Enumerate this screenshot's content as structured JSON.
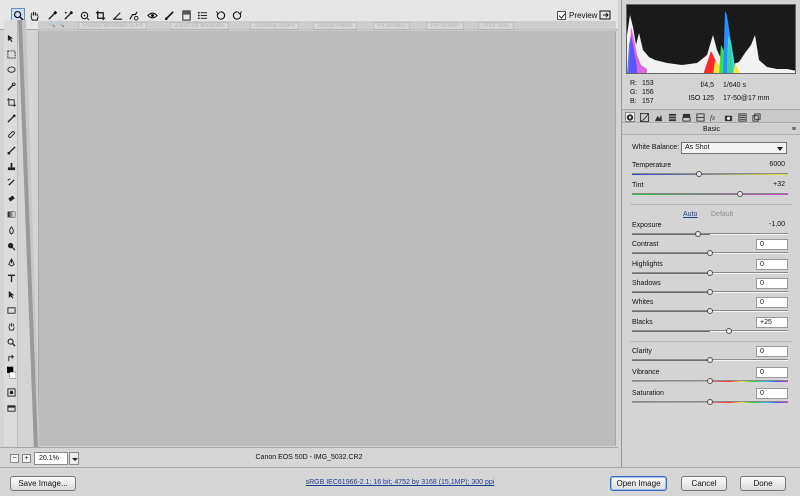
{
  "toolbar": {
    "tools": [
      "zoom-tool-icon",
      "hand-tool-icon",
      "white-balance-tool-icon",
      "color-sampler-tool-icon",
      "target-adjustment-tool-icon",
      "crop-tool-icon",
      "straighten-tool-icon",
      "spot-removal-tool-icon",
      "red-eye-removal-tool-icon",
      "adjustment-brush-icon",
      "graduated-filter-icon",
      "preferences-icon",
      "rotate-left-icon",
      "rotate-right-icon"
    ],
    "preview_label": "Preview",
    "preview_checked": true
  },
  "ghost_options": [
    "Resize Windows to Fit",
    "Zoom All Windows",
    "Scrubby Zoom",
    "Actual Pixels",
    "Fit Screen",
    "Fill Screen",
    "Print Size"
  ],
  "status": {
    "zoom_value": "20.1%",
    "filename": "Canon EOS 50D  -  IMG_5032.CR2"
  },
  "readout": {
    "r_label": "R:",
    "r_value": "153",
    "g_label": "G:",
    "g_value": "156",
    "b_label": "B:",
    "b_value": "157"
  },
  "camera": {
    "aperture": "f/4,5",
    "shutter": "1/640 s",
    "iso": "ISO 125",
    "lens": "17-50@17 mm"
  },
  "panel": {
    "title": "Basic",
    "white_balance_label": "White Balance:",
    "white_balance_value": "As Shot",
    "auto_label": "Auto",
    "default_label": "Default",
    "sliders": [
      {
        "label": "Temperature",
        "value": "6000",
        "pos": 0.43
      },
      {
        "label": "Tint",
        "value": "+32",
        "pos": 0.69
      },
      {
        "label": "Exposure",
        "value": "-1,00",
        "pos": 0.42
      },
      {
        "label": "Contrast",
        "value": "0",
        "pos": 0.5
      },
      {
        "label": "Highlights",
        "value": "0",
        "pos": 0.5
      },
      {
        "label": "Shadows",
        "value": "0",
        "pos": 0.5
      },
      {
        "label": "Whites",
        "value": "0",
        "pos": 0.5
      },
      {
        "label": "Blacks",
        "value": "+25",
        "pos": 0.62
      },
      {
        "label": "Clarity",
        "value": "0",
        "pos": 0.5
      },
      {
        "label": "Vibrance",
        "value": "0",
        "pos": 0.5
      },
      {
        "label": "Saturation",
        "value": "0",
        "pos": 0.5
      }
    ]
  },
  "bottom": {
    "save_label": "Save Image...",
    "workflow_label": "sRGB IEC61966-2.1; 16 bit; 4752 by 3168 (15,1MP); 300 ppi",
    "open_label": "Open Image",
    "cancel_label": "Cancel",
    "done_label": "Done"
  },
  "colors": {
    "temperature_gradient": [
      "#2a3fd0",
      "#e9e23a"
    ],
    "tint_gradient": [
      "#2fbf3a",
      "#cf3fcf"
    ],
    "link": "#1d3f94"
  }
}
